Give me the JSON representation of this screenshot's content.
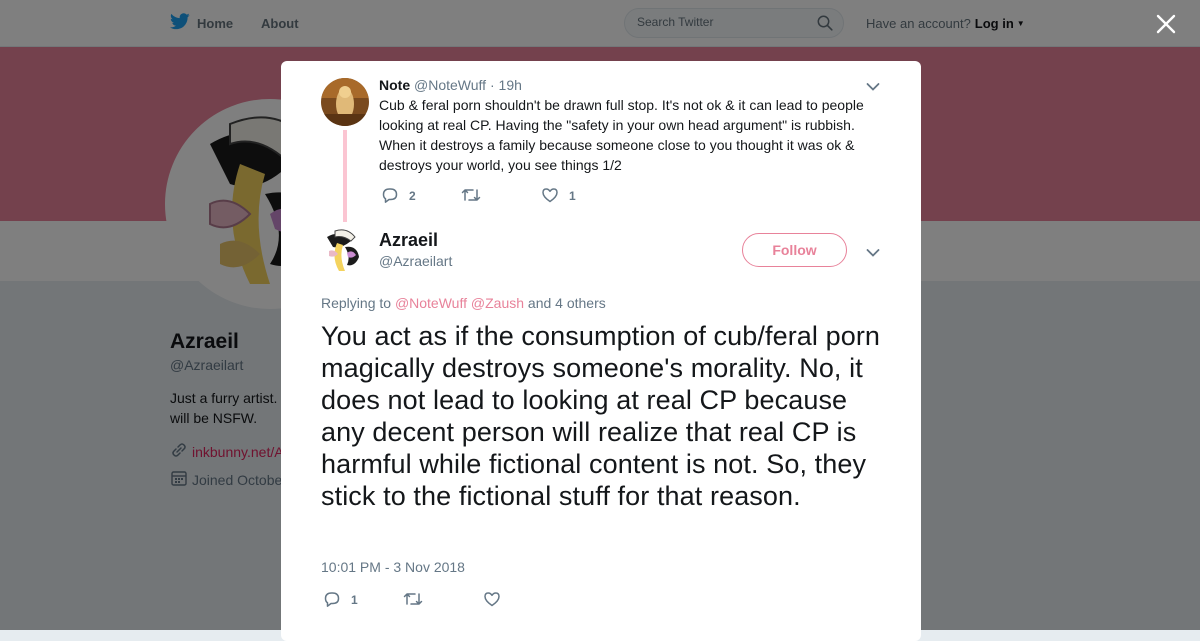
{
  "topbar": {
    "nav": [
      {
        "label": "Home",
        "icon": "twitter-bird-icon"
      },
      {
        "label": "About"
      }
    ],
    "search_placeholder": "Search Twitter",
    "account_prompt": "Have an account?",
    "login_label": "Log in"
  },
  "background_profile": {
    "name": "Azraeil",
    "handle": "@Azraeilart",
    "bio": "Just a furry artist. will be NSFW.",
    "link": "inkbunny.net/A",
    "joined": "Joined Octobe",
    "banner_color": "#e8829a"
  },
  "context_tweet": {
    "name": "Note",
    "handle": "@NoteWuff",
    "separator": "·",
    "time": "19h",
    "text": "Cub & feral porn shouldn't be drawn full stop. It's not ok & it can lead to people looking at real CP. Having the \"safety in your own head argument\" is rubbish. When it destroys a family because someone close to you thought it was ok & destroys your world, you see things 1/2",
    "reply_count": "2",
    "retweet_count": "",
    "like_count": "1"
  },
  "main_tweet": {
    "name": "Azraeil",
    "handle": "@Azraeilart",
    "follow_label": "Follow",
    "replying_prefix": "Replying to",
    "mention_1": "@NoteWuff",
    "mention_2": "@Zaush",
    "replying_suffix": "and 4 others",
    "text": "You act as if the consumption of cub/feral porn magically destroys someone's morality. No, it does not lead to looking at real CP because any decent person will realize that real CP is harmful while fictional content is not. So, they stick to the fictional stuff for that reason.",
    "timestamp": "10:01 PM - 3 Nov 2018",
    "reply_count": "1",
    "retweet_count": "",
    "like_count": ""
  },
  "colors": {
    "accent": "#e8829a",
    "twitter_blue": "#1da1f2",
    "thread_line": "#fbc5d2"
  }
}
